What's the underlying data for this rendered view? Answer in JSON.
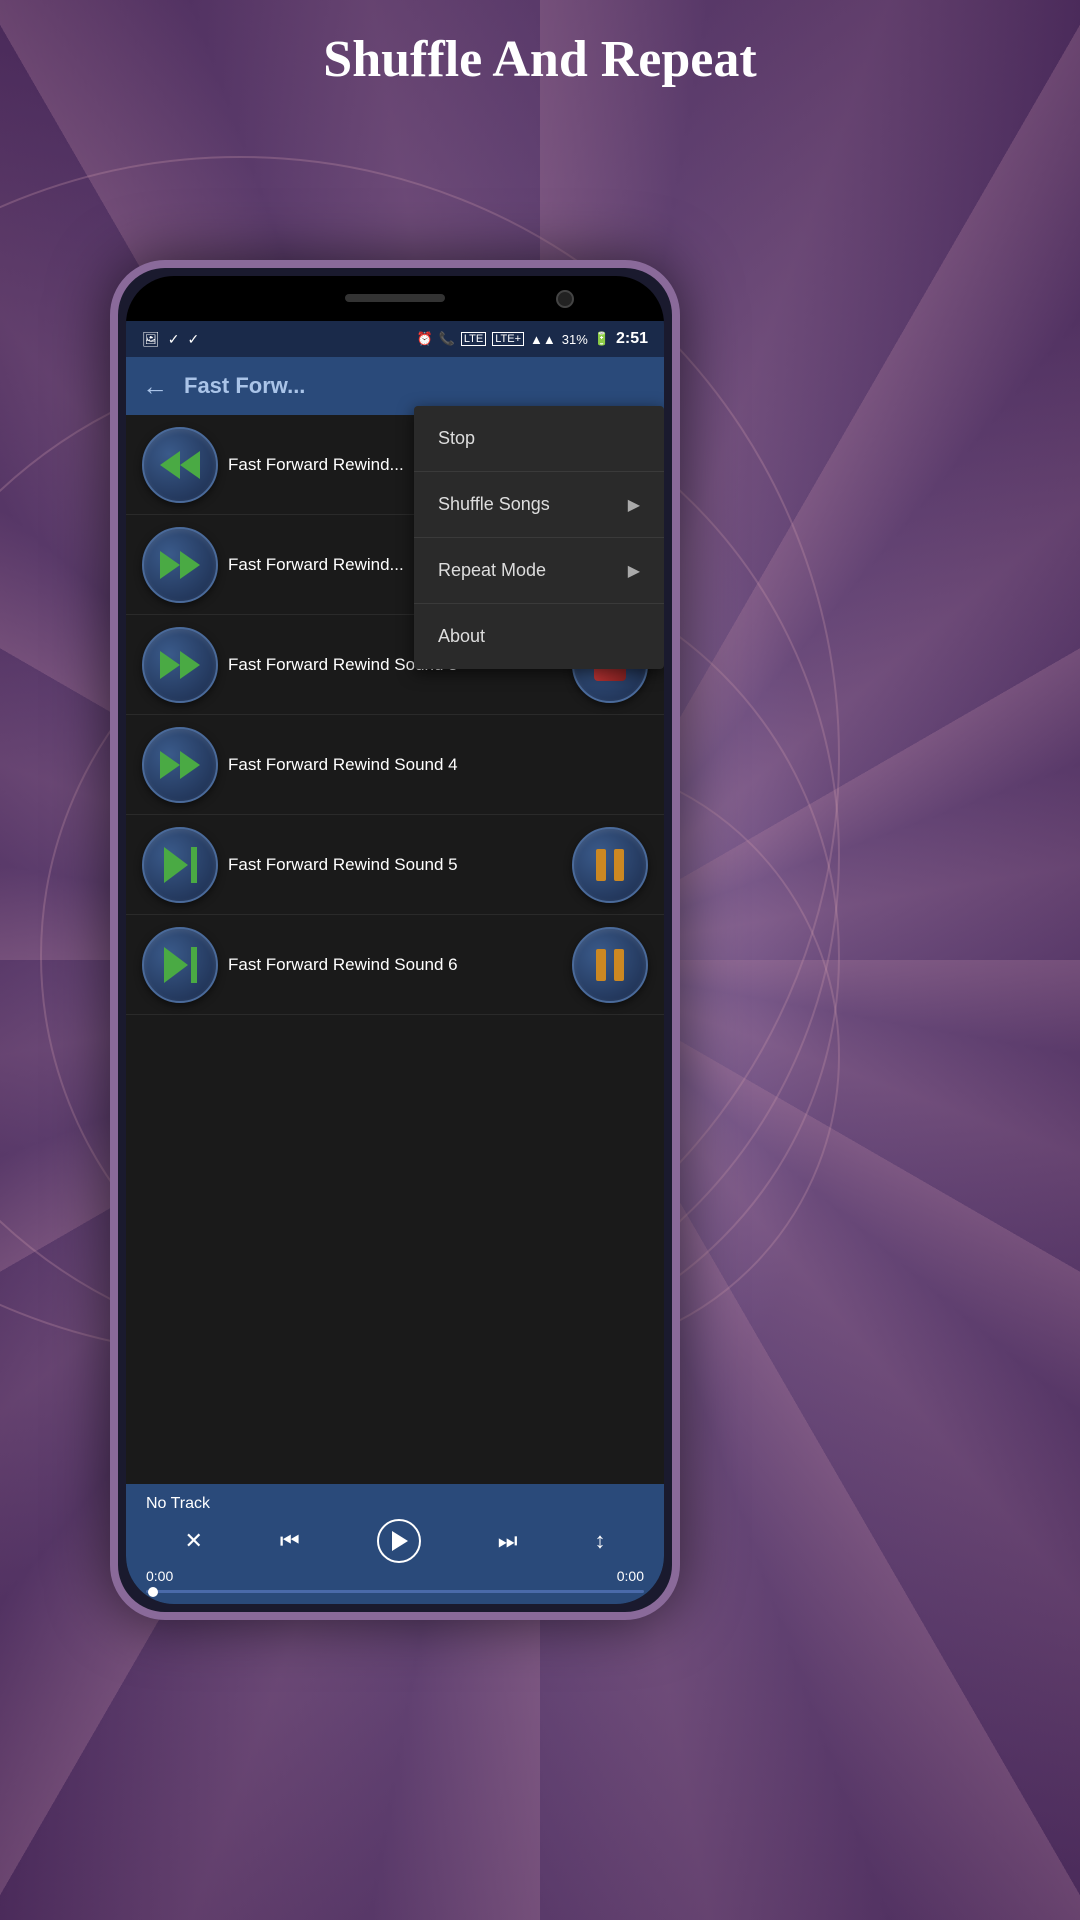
{
  "page": {
    "title": "Shuffle And Repeat",
    "background_color": "#7a5a8a"
  },
  "status_bar": {
    "alarm": "⏰",
    "phone": "📞",
    "lte1": "LTE",
    "lte2": "LTE+",
    "signal": "▲▲",
    "battery_pct": "31%",
    "battery": "🔋",
    "time": "2:51",
    "icons_left": [
      "🖼",
      "✓",
      "✓"
    ]
  },
  "app_bar": {
    "back_label": "←",
    "title": "Fast Forw..."
  },
  "songs": [
    {
      "name": "Fast Forward Rewind...",
      "button_type": "rewind"
    },
    {
      "name": "Fast Forward Rewind...",
      "button_type": "ff"
    },
    {
      "name": "Fast Forward Rewind Sound 3",
      "button_type": "ff",
      "button2_type": "stop"
    },
    {
      "name": "Fast Forward Rewind Sound 4",
      "button_type": "ff2",
      "button2_type": "stop"
    },
    {
      "name": "Fast Forward Rewind Sound 5",
      "button_type": "skip",
      "button2_type": "pause"
    },
    {
      "name": "Fast Forward Rewind Sound 6",
      "button_type": "skip",
      "button2_type": "pause"
    }
  ],
  "dropdown": {
    "items": [
      {
        "label": "Stop",
        "has_arrow": false
      },
      {
        "label": "Shuffle Songs",
        "has_arrow": true
      },
      {
        "label": "Repeat Mode",
        "has_arrow": true
      },
      {
        "label": "About",
        "has_arrow": false
      }
    ]
  },
  "player": {
    "no_track_label": "No Track",
    "time_start": "0:00",
    "time_end": "0:00"
  }
}
